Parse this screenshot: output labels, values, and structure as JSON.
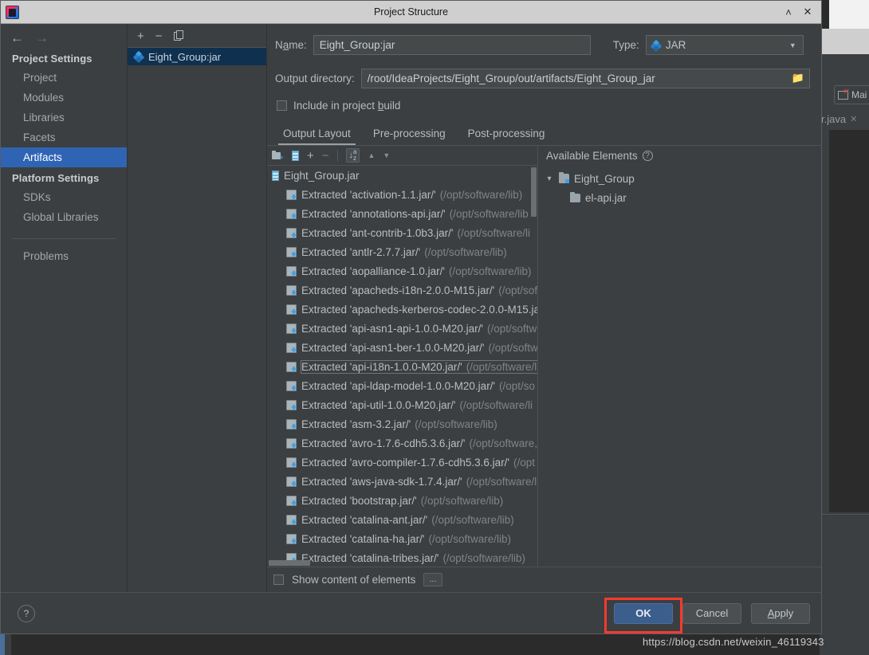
{
  "window": {
    "title": "Project Structure",
    "app_icon": "intellij-idea-icon",
    "minimize_label": "˄",
    "close_label": "✕"
  },
  "nav": {
    "back": "←",
    "forward": "→"
  },
  "sidebar": {
    "groups": [
      {
        "title": "Project Settings",
        "items": [
          {
            "label": "Project",
            "active": false
          },
          {
            "label": "Modules",
            "active": false
          },
          {
            "label": "Libraries",
            "active": false
          },
          {
            "label": "Facets",
            "active": false
          },
          {
            "label": "Artifacts",
            "active": true
          }
        ]
      },
      {
        "title": "Platform Settings",
        "items": [
          {
            "label": "SDKs",
            "active": false
          },
          {
            "label": "Global Libraries",
            "active": false
          }
        ]
      }
    ],
    "problems_label": "Problems"
  },
  "artifacts_panel": {
    "toolbar": {
      "add": "+",
      "remove": "−",
      "copy": "copy-icon"
    },
    "items": [
      {
        "label": "Eight_Group:jar",
        "icon": "jar-artifact-icon",
        "selected": true
      }
    ]
  },
  "form": {
    "name_label": "Name:",
    "name_label_mnemonic": "a",
    "name_value": "Eight_Group:jar",
    "type_label": "Type:",
    "type_value": "JAR",
    "type_caret": "▼",
    "output_dir_label": "Output directory:",
    "output_dir_value": "/root/IdeaProjects/Eight_Group/out/artifacts/Eight_Group_jar",
    "browse_icon": "folder-browse-icon",
    "include_in_build_label": "Include in project build",
    "include_in_build_checked": false
  },
  "tabs": [
    {
      "label": "Output Layout",
      "active": true
    },
    {
      "label": "Pre-processing",
      "active": false
    },
    {
      "label": "Post-processing",
      "active": false
    }
  ],
  "output_layout": {
    "toolbar": {
      "add_directory": "add-directory-icon",
      "add_archive": "add-archive-icon",
      "add": "+",
      "remove": "−",
      "sort": "sort-az-icon",
      "move_up": "▲",
      "move_down": "▼"
    },
    "root": {
      "label": "Eight_Group.jar",
      "icon": "archive-icon"
    },
    "entries": [
      {
        "name": "Extracted 'activation-1.1.jar/'",
        "path": "(/opt/software/lib)",
        "focused": false
      },
      {
        "name": "Extracted 'annotations-api.jar/'",
        "path": "(/opt/software/lib",
        "focused": false
      },
      {
        "name": "Extracted 'ant-contrib-1.0b3.jar/'",
        "path": "(/opt/software/li",
        "focused": false
      },
      {
        "name": "Extracted 'antlr-2.7.7.jar/'",
        "path": "(/opt/software/lib)",
        "focused": false
      },
      {
        "name": "Extracted 'aopalliance-1.0.jar/'",
        "path": "(/opt/software/lib)",
        "focused": false
      },
      {
        "name": "Extracted 'apacheds-i18n-2.0.0-M15.jar/'",
        "path": "(/opt/sof",
        "focused": false
      },
      {
        "name": "Extracted 'apacheds-kerberos-codec-2.0.0-M15.ja",
        "path": "",
        "focused": false
      },
      {
        "name": "Extracted 'api-asn1-api-1.0.0-M20.jar/'",
        "path": "(/opt/softw",
        "focused": false
      },
      {
        "name": "Extracted 'api-asn1-ber-1.0.0-M20.jar/'",
        "path": "(/opt/softw",
        "focused": false
      },
      {
        "name": "Extracted 'api-i18n-1.0.0-M20.jar/'",
        "path": "(/opt/software/lib)",
        "focused": true
      },
      {
        "name": "Extracted 'api-ldap-model-1.0.0-M20.jar/'",
        "path": "(/opt/so",
        "focused": false
      },
      {
        "name": "Extracted 'api-util-1.0.0-M20.jar/'",
        "path": "(/opt/software/li",
        "focused": false
      },
      {
        "name": "Extracted 'asm-3.2.jar/'",
        "path": "(/opt/software/lib)",
        "focused": false
      },
      {
        "name": "Extracted 'avro-1.7.6-cdh5.3.6.jar/'",
        "path": "(/opt/software,",
        "focused": false
      },
      {
        "name": "Extracted 'avro-compiler-1.7.6-cdh5.3.6.jar/'",
        "path": "(/opt",
        "focused": false
      },
      {
        "name": "Extracted 'aws-java-sdk-1.7.4.jar/'",
        "path": "(/opt/software/l",
        "focused": false
      },
      {
        "name": "Extracted 'bootstrap.jar/'",
        "path": "(/opt/software/lib)",
        "focused": false
      },
      {
        "name": "Extracted 'catalina-ant.jar/'",
        "path": "(/opt/software/lib)",
        "focused": false
      },
      {
        "name": "Extracted 'catalina-ha.jar/'",
        "path": "(/opt/software/lib)",
        "focused": false
      },
      {
        "name": "Extracted 'catalina-tribes.jar/'",
        "path": "(/opt/software/lib)",
        "focused": false
      }
    ],
    "available_elements_label": "Available Elements",
    "available_help_icon": "help-circle-icon",
    "available_tree": [
      {
        "label": "Eight_Group",
        "icon": "module-icon",
        "depth": 0,
        "expanded": true
      },
      {
        "label": "el-api.jar",
        "icon": "folder-icon",
        "depth": 1,
        "expanded": false
      }
    ],
    "show_content_label": "Show content of elements",
    "show_content_checked": false,
    "more_button_label": "..."
  },
  "footer": {
    "help_label": "?",
    "ok_label": "OK",
    "cancel_label": "Cancel",
    "apply_label": "Apply",
    "highlight_color": "#f33a2e"
  },
  "background": {
    "run_chip_label": "Mai",
    "editor_tab_label": "r.java",
    "editor_tab_close": "✕"
  },
  "watermark": {
    "text": "https://blog.csdn.net/weixin_46119343"
  },
  "colors": {
    "dialog_bg": "#3c3f41",
    "sidebar_active": "#2f64b4",
    "artifact_selected": "#103050",
    "accent_blue": "#3aa0e8",
    "ok_button": "#3c5e8c",
    "field_bg": "#45494a"
  }
}
